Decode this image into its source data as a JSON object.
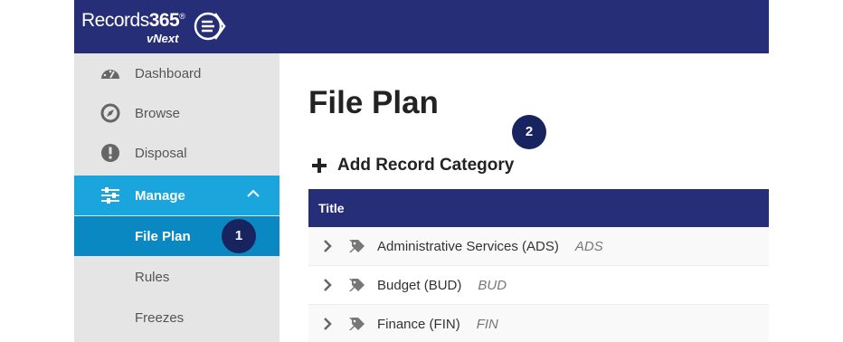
{
  "brand": {
    "name_prefix": "Records",
    "name_number": "365",
    "trademark": "®",
    "sub": "vNext"
  },
  "sidebar": {
    "items": [
      {
        "label": "Dashboard",
        "icon": "dashboard-icon"
      },
      {
        "label": "Browse",
        "icon": "compass-icon"
      },
      {
        "label": "Disposal",
        "icon": "exclamation-icon"
      },
      {
        "label": "Manage",
        "icon": "sliders-icon",
        "expanded": true
      }
    ],
    "subitems": [
      {
        "label": "File Plan",
        "active": true
      },
      {
        "label": "Rules"
      },
      {
        "label": "Freezes"
      }
    ]
  },
  "callouts": {
    "one": "1",
    "two": "2"
  },
  "main": {
    "title": "File Plan",
    "add_label": "Add Record Category",
    "table": {
      "header": "Title",
      "rows": [
        {
          "name": "Administrative Services (ADS)",
          "code": "ADS"
        },
        {
          "name": "Budget (BUD)",
          "code": "BUD"
        },
        {
          "name": "Finance (FIN)",
          "code": "FIN"
        }
      ]
    }
  },
  "colors": {
    "navy": "#272e78",
    "accent": "#1aa6dc",
    "accent_dark": "#0a88c1",
    "badge": "#18245f",
    "sidebar_bg": "#e5e5e5"
  }
}
